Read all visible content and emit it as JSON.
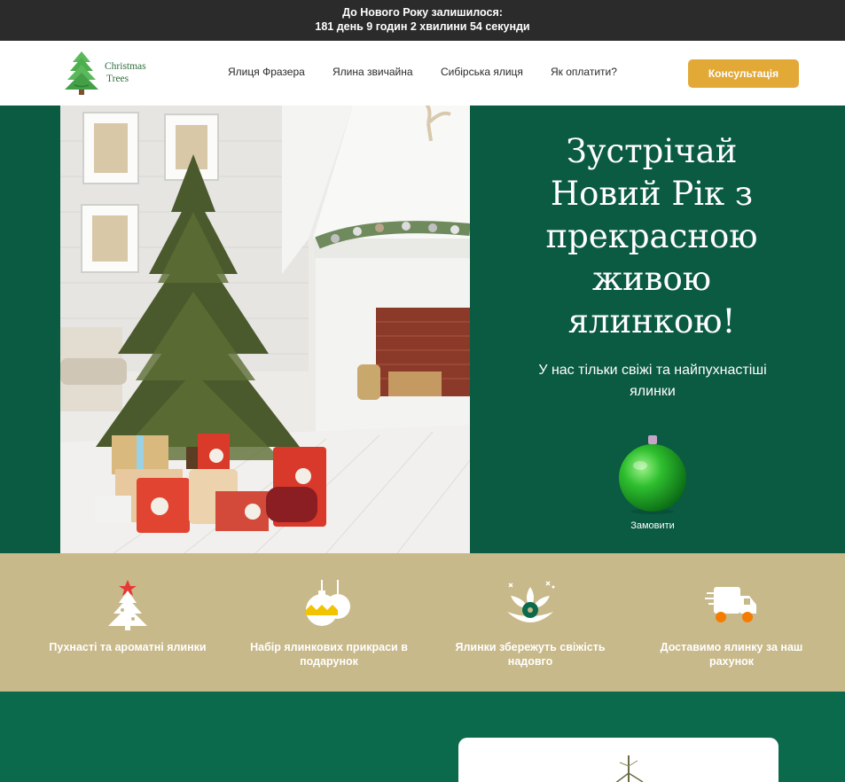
{
  "countdown": {
    "line1": "До Нового Року залишилося:",
    "line2": "181 день 9 годин 2 хвилини 54 секунди"
  },
  "header": {
    "logo": {
      "line1": "Christmas",
      "line2": "Trees"
    },
    "nav": [
      {
        "label": "Ялиця Фразера"
      },
      {
        "label": "Ялина звичайна"
      },
      {
        "label": "Сибірська ялиця"
      },
      {
        "label": "Як оплатити?"
      }
    ],
    "consult_label": "Консультація",
    "accent": "#e2a936"
  },
  "hero": {
    "title_lines": [
      "Зустрічай",
      "Новий Рік з",
      "прекрасною",
      "живою",
      "ялинкою!"
    ],
    "subtitle": "У нас тільки свіжі та найпухнастіші ялинки",
    "order_label": "Замовити",
    "bg": "#0b5a42"
  },
  "features": [
    {
      "icon": "christmas-tree-icon",
      "text": "Пухнасті та ароматні ялинки"
    },
    {
      "icon": "ornaments-icon",
      "text": "Набір ялинкових прикраси в подарунок"
    },
    {
      "icon": "flower-freshness-icon",
      "text": "Ялинки збережуть свіжість надовго"
    },
    {
      "icon": "delivery-truck-icon",
      "text": "Доставимо ялинку за наш рахунок"
    }
  ]
}
